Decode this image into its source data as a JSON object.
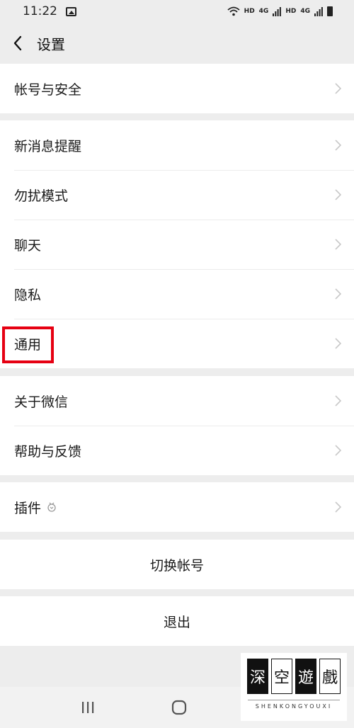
{
  "status_bar": {
    "time": "11:22",
    "network_labels": [
      "HD",
      "4G",
      "HD",
      "4G"
    ]
  },
  "header": {
    "title": "设置"
  },
  "groups": [
    [
      {
        "label": "帐号与安全"
      }
    ],
    [
      {
        "label": "新消息提醒"
      },
      {
        "label": "勿扰模式"
      },
      {
        "label": "聊天"
      },
      {
        "label": "隐私"
      },
      {
        "label": "通用"
      }
    ],
    [
      {
        "label": "关于微信"
      },
      {
        "label": "帮助与反馈"
      }
    ],
    [
      {
        "label": "插件"
      }
    ]
  ],
  "actions": {
    "switch_account": "切换帐号",
    "logout": "退出"
  },
  "highlight": {
    "target": "通用",
    "color": "#e60012"
  },
  "watermark": {
    "chars": [
      "深",
      "空",
      "遊",
      "戲"
    ],
    "subtitle": "SHENKONGYOUXI"
  },
  "colors": {
    "background": "#ededed",
    "card": "#ffffff",
    "highlight": "#e60012"
  }
}
